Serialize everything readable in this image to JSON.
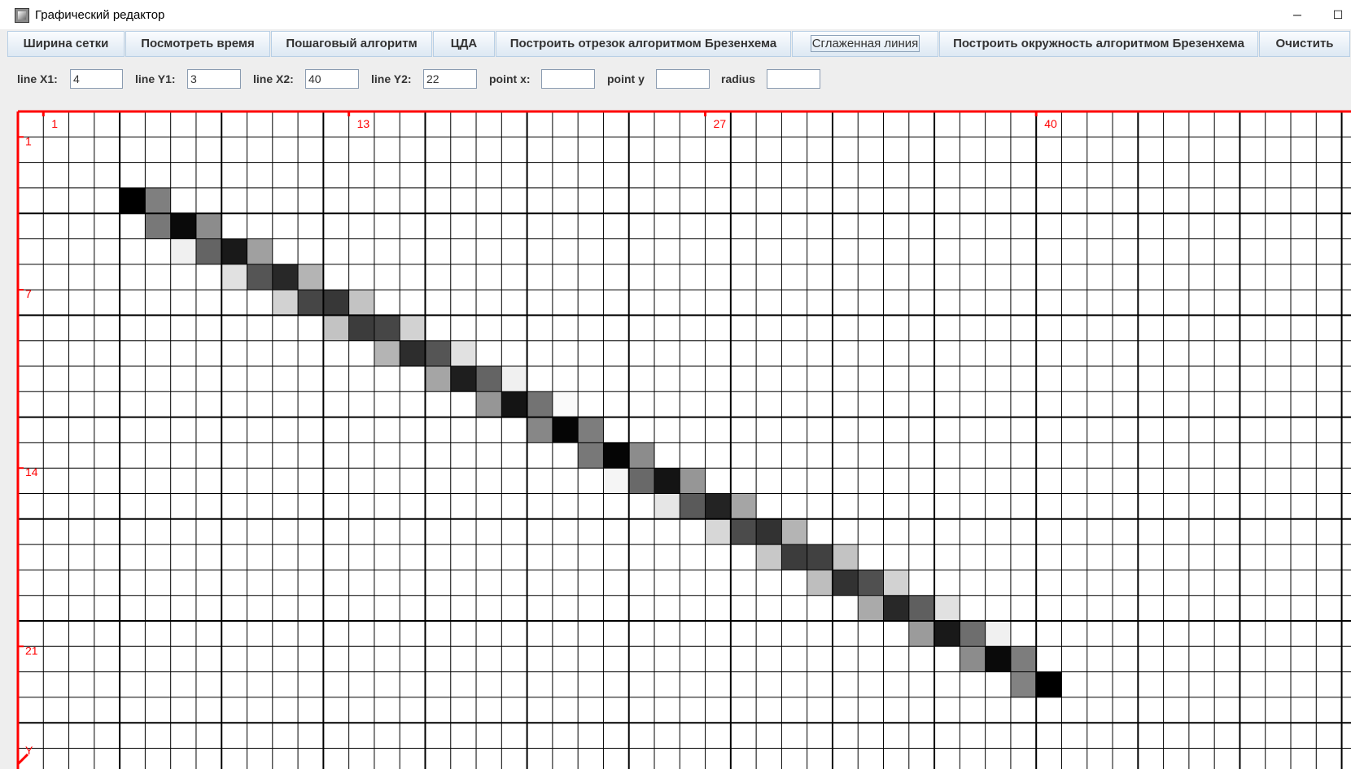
{
  "window": {
    "title": "Графический редактор",
    "controls": [
      "─",
      "☐"
    ]
  },
  "toolbar": {
    "buttons": [
      {
        "label": "Ширина сетки"
      },
      {
        "label": "Посмотреть время"
      },
      {
        "label": "Пошаговый алгоритм"
      },
      {
        "label": "ЦДА"
      },
      {
        "label": "Построить отрезок алгоритмом Брезенхема"
      },
      {
        "label": "Сглаженная линия",
        "focused": true
      },
      {
        "label": "Построить окружность алгоритмом Брезенхема"
      },
      {
        "label": "Очистить"
      }
    ]
  },
  "inputs": [
    {
      "label": "line X1:",
      "value": "4"
    },
    {
      "label": "line Y1:",
      "value": "3"
    },
    {
      "label": "line X2:",
      "value": "40"
    },
    {
      "label": "line Y2:",
      "value": "22"
    },
    {
      "label": "point x:",
      "value": ""
    },
    {
      "label": "point y",
      "value": ""
    },
    {
      "label": "radius",
      "value": ""
    }
  ],
  "grid": {
    "x_labels": [
      {
        "col": 1,
        "text": "1"
      },
      {
        "col": 13,
        "text": "13"
      },
      {
        "col": 27,
        "text": "27"
      },
      {
        "col": 40,
        "text": "40"
      }
    ],
    "y_labels": [
      {
        "row": 1,
        "text": "1"
      },
      {
        "row": 7,
        "text": "7"
      },
      {
        "row": 14,
        "text": "14"
      },
      {
        "row": 21,
        "text": "21"
      }
    ],
    "axis_y_letter": "Y",
    "axis_color": "#ff0000",
    "pixels": [
      [
        4,
        3,
        0
      ],
      [
        5,
        3,
        127
      ],
      [
        5,
        4,
        120
      ],
      [
        6,
        4,
        10
      ],
      [
        7,
        4,
        140
      ],
      [
        6,
        5,
        240
      ],
      [
        7,
        5,
        100
      ],
      [
        8,
        5,
        25
      ],
      [
        9,
        5,
        160
      ],
      [
        8,
        6,
        225
      ],
      [
        9,
        6,
        85
      ],
      [
        10,
        6,
        40
      ],
      [
        11,
        6,
        180
      ],
      [
        10,
        7,
        210
      ],
      [
        11,
        7,
        70
      ],
      [
        12,
        7,
        55
      ],
      [
        13,
        7,
        195
      ],
      [
        12,
        8,
        195
      ],
      [
        13,
        8,
        60
      ],
      [
        14,
        8,
        70
      ],
      [
        15,
        8,
        210
      ],
      [
        14,
        9,
        180
      ],
      [
        15,
        9,
        45
      ],
      [
        16,
        9,
        85
      ],
      [
        17,
        9,
        225
      ],
      [
        16,
        10,
        165
      ],
      [
        17,
        10,
        30
      ],
      [
        18,
        10,
        100
      ],
      [
        19,
        10,
        240
      ],
      [
        18,
        11,
        150
      ],
      [
        19,
        11,
        20
      ],
      [
        20,
        11,
        115
      ],
      [
        21,
        11,
        250
      ],
      [
        20,
        12,
        135
      ],
      [
        21,
        12,
        5
      ],
      [
        22,
        12,
        125
      ],
      [
        22,
        13,
        120
      ],
      [
        23,
        13,
        5
      ],
      [
        24,
        13,
        140
      ],
      [
        23,
        14,
        245
      ],
      [
        24,
        14,
        105
      ],
      [
        25,
        14,
        20
      ],
      [
        26,
        14,
        150
      ],
      [
        25,
        15,
        230
      ],
      [
        26,
        15,
        90
      ],
      [
        27,
        15,
        35
      ],
      [
        28,
        15,
        165
      ],
      [
        27,
        16,
        215
      ],
      [
        28,
        16,
        75
      ],
      [
        29,
        16,
        50
      ],
      [
        30,
        16,
        180
      ],
      [
        29,
        17,
        200
      ],
      [
        30,
        17,
        60
      ],
      [
        31,
        17,
        65
      ],
      [
        32,
        17,
        195
      ],
      [
        31,
        18,
        190
      ],
      [
        32,
        18,
        50
      ],
      [
        33,
        18,
        80
      ],
      [
        34,
        18,
        210
      ],
      [
        33,
        19,
        170
      ],
      [
        34,
        19,
        40
      ],
      [
        35,
        19,
        95
      ],
      [
        36,
        19,
        225
      ],
      [
        35,
        20,
        155
      ],
      [
        36,
        20,
        25
      ],
      [
        37,
        20,
        110
      ],
      [
        38,
        20,
        240
      ],
      [
        37,
        21,
        140
      ],
      [
        38,
        21,
        10
      ],
      [
        39,
        21,
        125
      ],
      [
        39,
        22,
        130
      ],
      [
        40,
        22,
        0
      ]
    ]
  }
}
